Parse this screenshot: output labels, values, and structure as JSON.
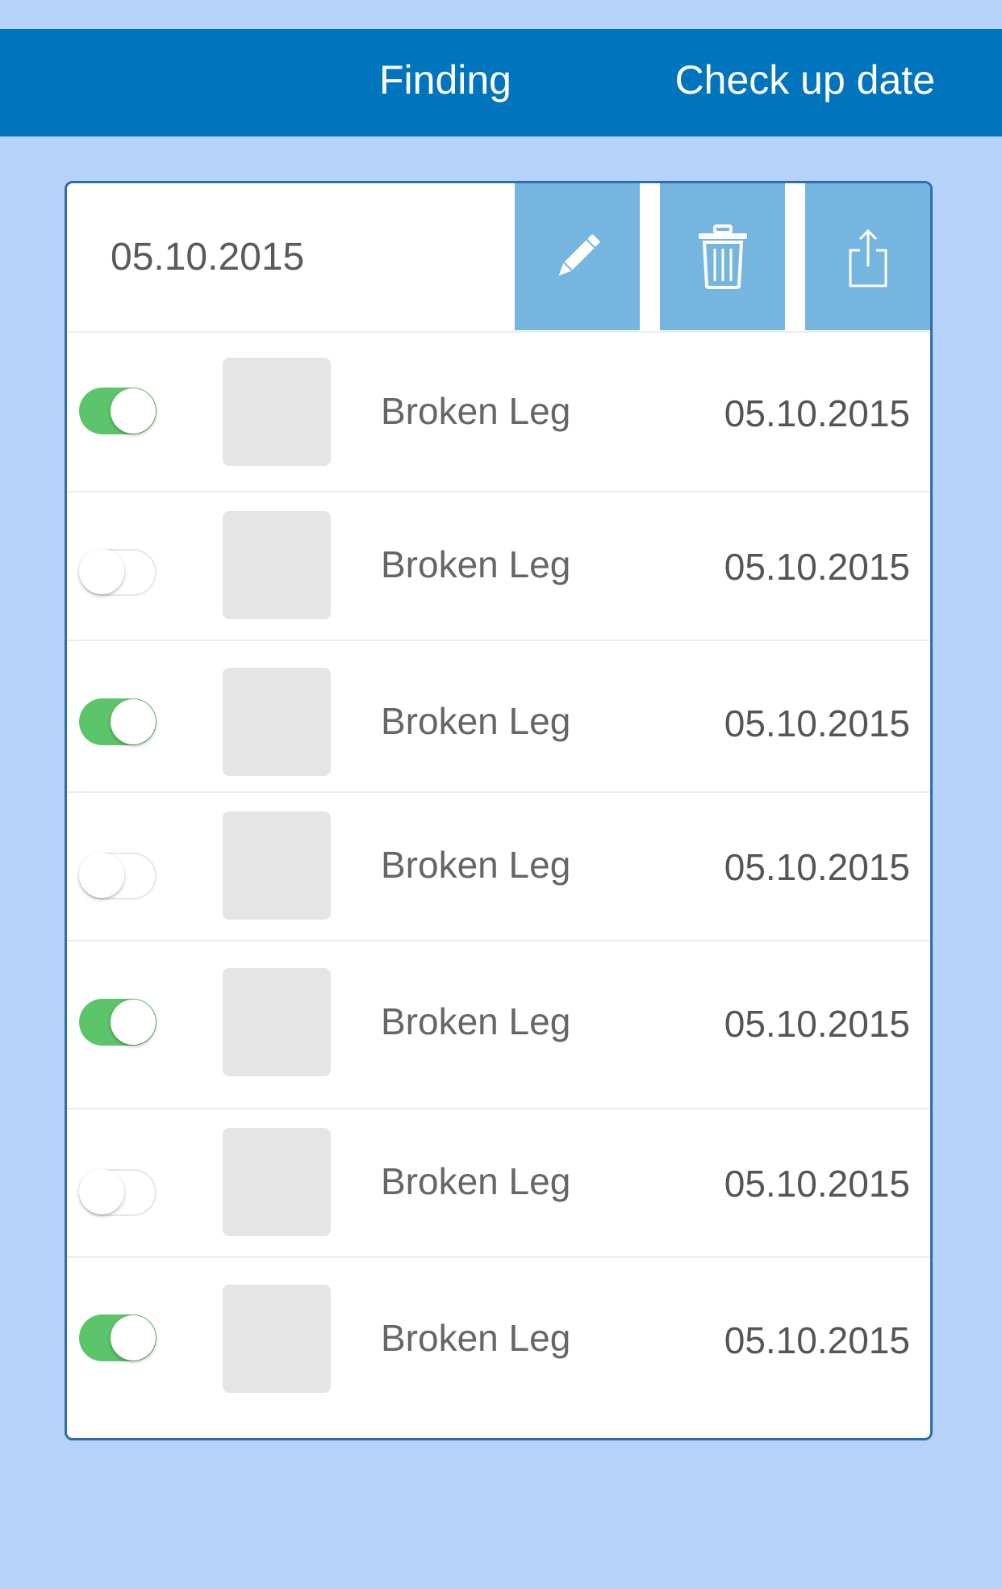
{
  "header": {
    "finding_label": "Finding",
    "checkup_label": "Check up date",
    "background_color": "#0074bd"
  },
  "page_background_color": "#b6d2fa",
  "card": {
    "date": "05.10.2015",
    "actions": [
      {
        "icon": "pencil-icon",
        "label": "edit"
      },
      {
        "icon": "trash-icon",
        "label": "delete"
      },
      {
        "icon": "share-icon",
        "label": "share"
      }
    ],
    "action_color": "#76b5df"
  },
  "toggle_on_color": "#5cc46a",
  "rows": [
    {
      "enabled": true,
      "finding": "Broken Leg",
      "date": "05.10.2015"
    },
    {
      "enabled": false,
      "finding": "Broken Leg",
      "date": "05.10.2015"
    },
    {
      "enabled": true,
      "finding": "Broken Leg",
      "date": "05.10.2015"
    },
    {
      "enabled": false,
      "finding": "Broken Leg",
      "date": "05.10.2015"
    },
    {
      "enabled": true,
      "finding": "Broken Leg",
      "date": "05.10.2015"
    },
    {
      "enabled": false,
      "finding": "Broken Leg",
      "date": "05.10.2015"
    },
    {
      "enabled": true,
      "finding": "Broken Leg",
      "date": "05.10.2015"
    }
  ]
}
